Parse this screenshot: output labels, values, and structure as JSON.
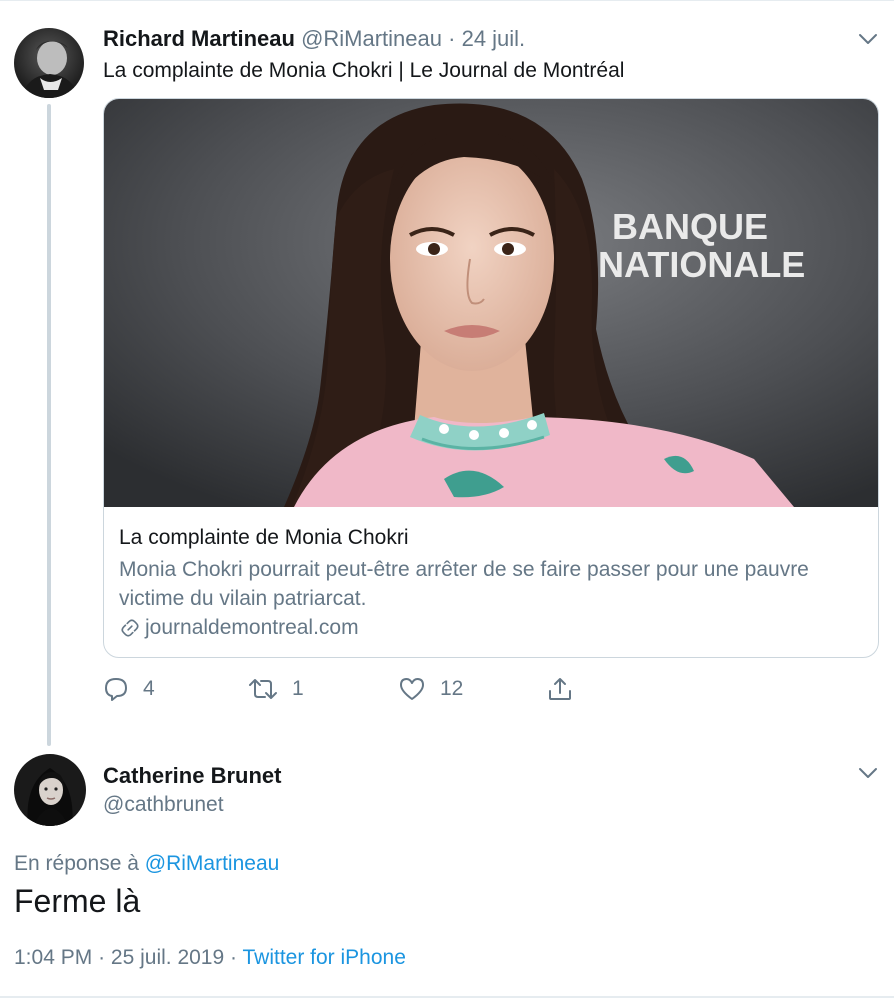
{
  "tweet1": {
    "name": "Richard Martineau",
    "handle": "@RiMartineau",
    "separator": "·",
    "date": "24 juil.",
    "text": "La complainte de Monia Chokri | Le Journal de Montréal",
    "card": {
      "image_text_line1": "BANQUE",
      "image_text_line2": "NATIONALE",
      "title": "La complainte de Monia Chokri",
      "description": "Monia Chokri pourrait peut-être arrêter de se faire passer pour une pauvre victime du vilain patriarcat.",
      "domain": "journaldemontreal.com",
      "link_icon": "link-icon"
    },
    "actions": {
      "reply_count": "4",
      "retweet_count": "1",
      "like_count": "12",
      "reply_icon": "reply-icon",
      "retweet_icon": "retweet-icon",
      "like_icon": "heart-icon",
      "share_icon": "share-icon"
    }
  },
  "tweet2": {
    "name": "Catherine Brunet",
    "handle": "@cathbrunet",
    "reply_prefix": "En réponse à",
    "reply_to": "@RiMartineau",
    "text": "Ferme là",
    "time": "1:04 PM",
    "separator": "·",
    "date": "25 juil. 2019",
    "source": "Twitter for iPhone"
  },
  "colors": {
    "text": "#14171a",
    "muted": "#657786",
    "link": "#1b95e0",
    "border": "#ccd6dd"
  }
}
